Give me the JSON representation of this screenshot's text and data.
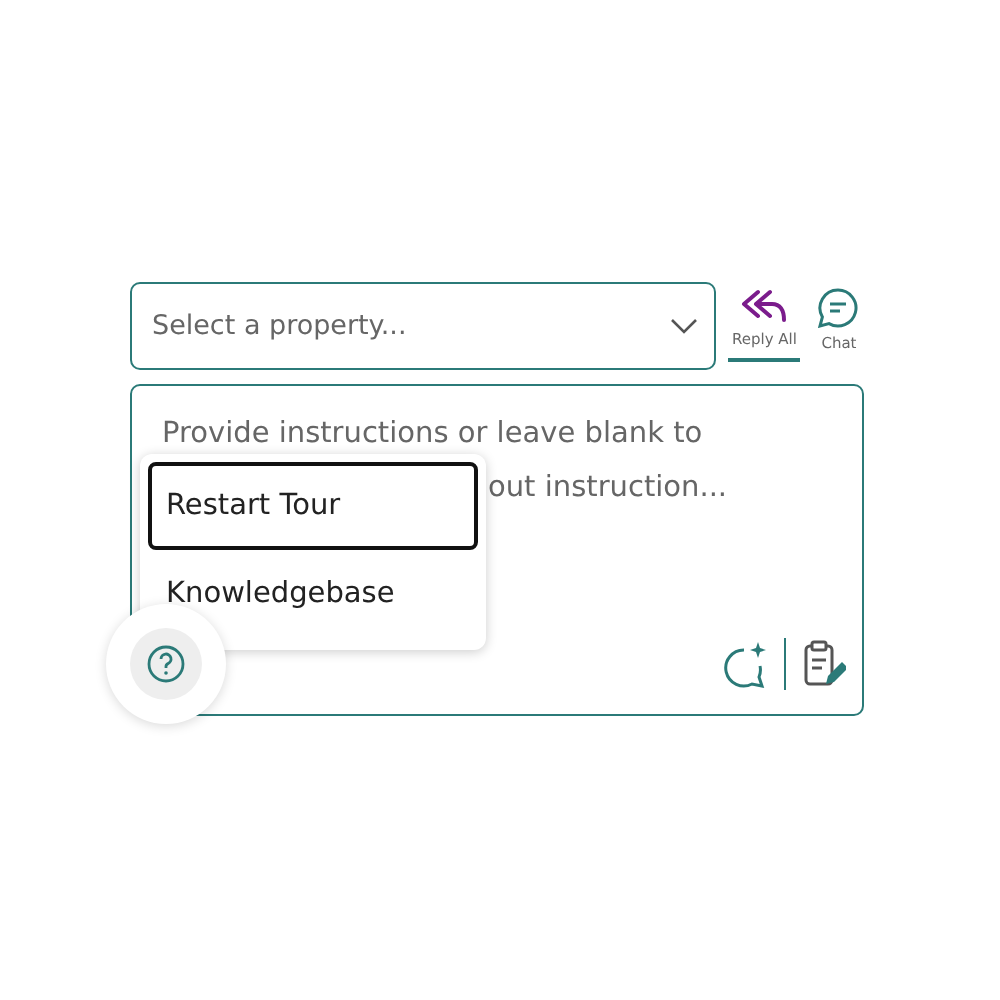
{
  "property_select": {
    "placeholder": "Select a property..."
  },
  "tabs": [
    {
      "label": "Reply All",
      "kind": "reply-all",
      "selected": true
    },
    {
      "label": "Chat",
      "kind": "chat",
      "selected": false
    }
  ],
  "instructions": {
    "placeholder_lines": [
      "Provide instructions or leave blank to",
      "out instruction..."
    ]
  },
  "help_menu": {
    "items": [
      {
        "label": "Restart Tour",
        "selected": true
      },
      {
        "label": "Knowledgebase",
        "selected": false
      }
    ]
  }
}
